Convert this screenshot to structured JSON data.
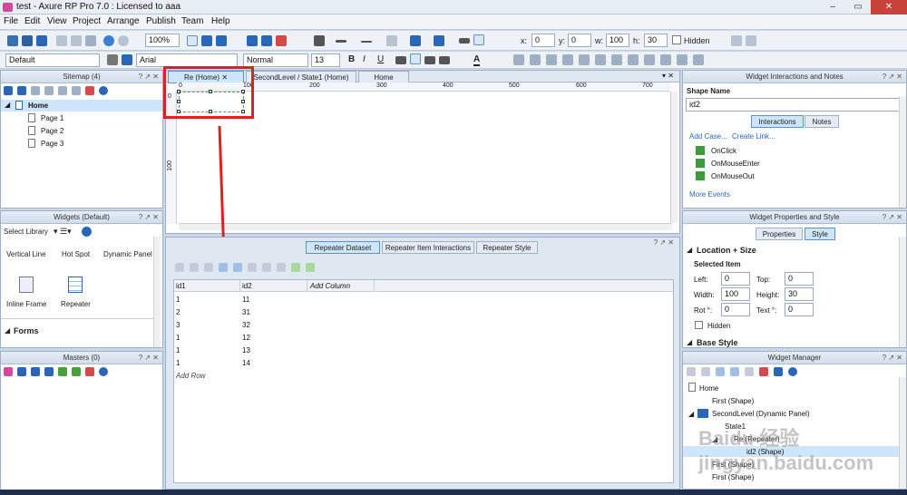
{
  "app": {
    "title": "test - Axure RP Pro 7.0 : Licensed to aaa",
    "window_controls": {
      "min": "–",
      "max": "▭",
      "close": "✕"
    }
  },
  "menu": [
    "File",
    "Edit",
    "View",
    "Project",
    "Arrange",
    "Publish",
    "Team",
    "Help"
  ],
  "toolbar": {
    "zoom": "100%",
    "x_label": "x:",
    "x": "0",
    "y_label": "y:",
    "y": "0",
    "w_label": "w:",
    "w": "100",
    "h_label": "h:",
    "h": "30",
    "hidden_label": "Hidden",
    "style": "Default",
    "font": "Arial",
    "weight": "Normal",
    "size": "13",
    "bold": "B",
    "italic": "I",
    "underline": "U",
    "text_color": "A"
  },
  "sitemap": {
    "title": "Sitemap (4)",
    "items": [
      "Home",
      "Page 1",
      "Page 2",
      "Page 3"
    ]
  },
  "widgets": {
    "title": "Widgets (Default)",
    "library_label": "Select Library",
    "items": [
      "Vertical Line",
      "Hot Spot",
      "Dynamic Panel",
      "Inline Frame",
      "Repeater"
    ],
    "section": "Forms"
  },
  "masters": {
    "title": "Masters (0)"
  },
  "tabs": [
    "Re (Home)",
    "SecondLevel / State1 (Home)",
    "Home"
  ],
  "ruler": {
    "h_ticks": [
      "0",
      "100",
      "200",
      "300",
      "400",
      "500",
      "600",
      "700"
    ],
    "v_ticks": [
      "0",
      "100"
    ]
  },
  "repeater": {
    "tabs": [
      "Repeater Dataset",
      "Repeater Item Interactions",
      "Repeater Style"
    ],
    "columns": [
      "id1",
      "id2",
      "Add Column"
    ],
    "rows": [
      [
        "1",
        "11"
      ],
      [
        "2",
        "31"
      ],
      [
        "3",
        "32"
      ],
      [
        "1",
        "12"
      ],
      [
        "1",
        "13"
      ],
      [
        "1",
        "14"
      ]
    ],
    "add_row": "Add Row"
  },
  "interactions": {
    "title": "Widget Interactions and Notes",
    "shape_name_label": "Shape Name",
    "shape_name": "id2",
    "tabs": [
      "Interactions",
      "Notes"
    ],
    "add_case": "Add Case...",
    "create_link": "Create Link...",
    "events": [
      "OnClick",
      "OnMouseEnter",
      "OnMouseOut"
    ],
    "more_events": "More Events"
  },
  "properties": {
    "title": "Widget Properties and Style",
    "tabs": [
      "Properties",
      "Style"
    ],
    "section": "Location + Size",
    "subsection": "Selected Item",
    "left_label": "Left:",
    "left": "0",
    "top_label": "Top:",
    "top": "0",
    "width_label": "Width:",
    "width": "100",
    "height_label": "Height:",
    "height": "30",
    "rot_label": "Rot °:",
    "rot": "0",
    "text_label": "Text °:",
    "text": "0",
    "hidden_label": "Hidden",
    "base_style": "Base Style"
  },
  "manager": {
    "title": "Widget Manager",
    "items": [
      "Home",
      "First (Shape)",
      "SecondLevel (Dynamic Panel)",
      "State1",
      "Re (Repeater)",
      "id2 (Shape)",
      "First (Shape)",
      "First (Shape)"
    ]
  },
  "watermark": "Baidu 经验 jingyan.baidu.com",
  "colors": {
    "accent": "#2a66b8",
    "highlight_box": "#e02020",
    "selection": "#cde6fb"
  }
}
